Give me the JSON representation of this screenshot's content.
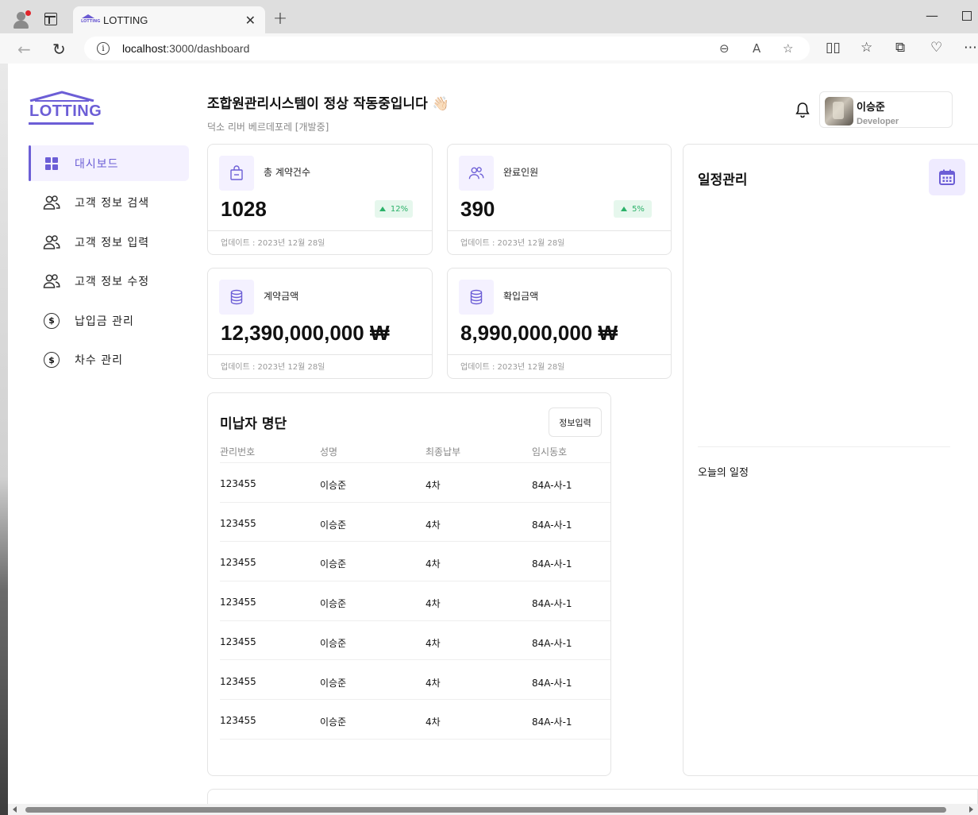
{
  "browser": {
    "tab_title": "LOTTING",
    "url_host": "localhost",
    "url_path": ":3000/dashboard",
    "favicon_text": "LOTTING"
  },
  "logo": {
    "text": "LOTTING",
    "color": "#6c5ed6"
  },
  "sidebar": {
    "items": [
      {
        "label": "대시보드",
        "icon": "dashboard-grid-icon",
        "active": true
      },
      {
        "label": "고객 정보 검색",
        "icon": "users-icon"
      },
      {
        "label": "고객 정보 입력",
        "icon": "users-icon"
      },
      {
        "label": "고객 정보 수정",
        "icon": "users-icon"
      },
      {
        "label": "납입금 관리",
        "icon": "dollar-icon"
      },
      {
        "label": "차수 관리",
        "icon": "dollar-icon"
      }
    ]
  },
  "header": {
    "greeting": "조합원관리시스템이 정상 작동중입니다 👋🏻",
    "subtitle": "덕소 리버 베르데포레 [개발중]"
  },
  "user": {
    "name": "이승준",
    "role": "Developer"
  },
  "stats": [
    {
      "label": "총 계약건수",
      "value": "1028",
      "change": "12%",
      "updated": "업데이트 : 2023년 12월 28일",
      "icon": "shopping-bag-icon"
    },
    {
      "label": "완료인원",
      "value": "390",
      "change": "5%",
      "updated": "업데이트 : 2023년 12월 28일",
      "icon": "users-icon"
    },
    {
      "label": "계약금액",
      "value": "12,390,000,000 ₩",
      "updated": "업데이트 : 2023년 12월 28일",
      "icon": "database-icon"
    },
    {
      "label": "확입금액",
      "value": "8,990,000,000 ₩",
      "updated": "업데이트 : 2023년 12월 28일",
      "icon": "database-icon"
    }
  ],
  "unpaid": {
    "title": "미납자 명단",
    "button": "정보입력",
    "columns": [
      "관리번호",
      "성명",
      "최종납부",
      "임시동호"
    ],
    "rows": [
      [
        "123455",
        "이승준",
        "4차",
        "84A-사-1"
      ],
      [
        "123455",
        "이승준",
        "4차",
        "84A-사-1"
      ],
      [
        "123455",
        "이승준",
        "4차",
        "84A-사-1"
      ],
      [
        "123455",
        "이승준",
        "4차",
        "84A-사-1"
      ],
      [
        "123455",
        "이승준",
        "4차",
        "84A-사-1"
      ],
      [
        "123455",
        "이승준",
        "4차",
        "84A-사-1"
      ],
      [
        "123455",
        "이승준",
        "4차",
        "84A-사-1"
      ]
    ]
  },
  "schedule": {
    "title": "일정관리",
    "today_label": "오늘의 일정"
  },
  "colors": {
    "accent": "#6c5ed6",
    "accent_bg": "#f4f1ff",
    "positive": "#2bb169"
  }
}
